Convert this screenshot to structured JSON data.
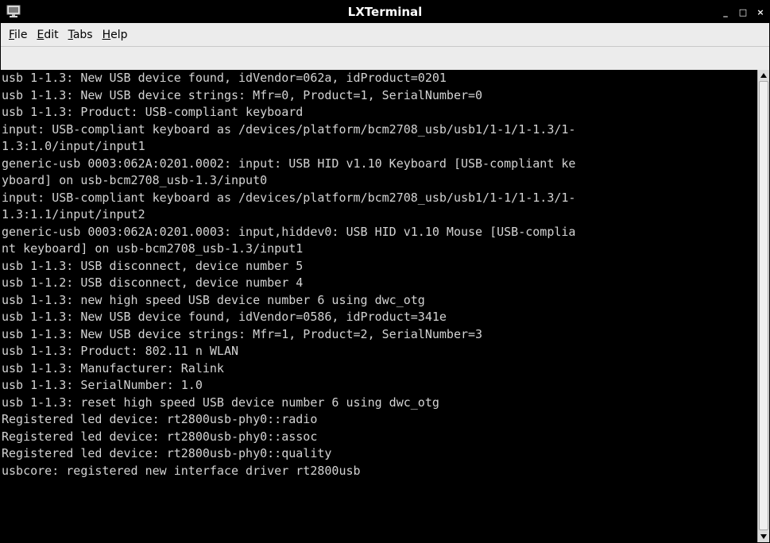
{
  "window": {
    "title": "LXTerminal",
    "controls": {
      "minimize": "_",
      "maximize": "□",
      "close": "×"
    }
  },
  "menu": {
    "items": [
      {
        "id": "file",
        "underline": "F",
        "rest": "ile"
      },
      {
        "id": "edit",
        "underline": "E",
        "rest": "dit"
      },
      {
        "id": "tabs",
        "underline": "T",
        "rest": "abs"
      },
      {
        "id": "help",
        "underline": "H",
        "rest": "elp"
      }
    ]
  },
  "terminal": {
    "lines": [
      "usb 1-1.3: New USB device found, idVendor=062a, idProduct=0201",
      "usb 1-1.3: New USB device strings: Mfr=0, Product=1, SerialNumber=0",
      "usb 1-1.3: Product: USB-compliant keyboard",
      "input: USB-compliant keyboard as /devices/platform/bcm2708_usb/usb1/1-1/1-1.3/1-",
      "1.3:1.0/input/input1",
      "generic-usb 0003:062A:0201.0002: input: USB HID v1.10 Keyboard [USB-compliant ke",
      "yboard] on usb-bcm2708_usb-1.3/input0",
      "input: USB-compliant keyboard as /devices/platform/bcm2708_usb/usb1/1-1/1-1.3/1-",
      "1.3:1.1/input/input2",
      "generic-usb 0003:062A:0201.0003: input,hiddev0: USB HID v1.10 Mouse [USB-complia",
      "nt keyboard] on usb-bcm2708_usb-1.3/input1",
      "usb 1-1.3: USB disconnect, device number 5",
      "usb 1-1.2: USB disconnect, device number 4",
      "usb 1-1.3: new high speed USB device number 6 using dwc_otg",
      "usb 1-1.3: New USB device found, idVendor=0586, idProduct=341e",
      "usb 1-1.3: New USB device strings: Mfr=1, Product=2, SerialNumber=3",
      "usb 1-1.3: Product: 802.11 n WLAN",
      "usb 1-1.3: Manufacturer: Ralink",
      "usb 1-1.3: SerialNumber: 1.0",
      "usb 1-1.3: reset high speed USB device number 6 using dwc_otg",
      "Registered led device: rt2800usb-phy0::radio",
      "Registered led device: rt2800usb-phy0::assoc",
      "Registered led device: rt2800usb-phy0::quality",
      "usbcore: registered new interface driver rt2800usb"
    ]
  },
  "icons": {
    "app": "terminal-app-icon",
    "scroll_up": "arrow-up-icon",
    "scroll_down": "arrow-down-icon"
  },
  "colors": {
    "terminal_bg": "#000000",
    "terminal_fg": "#d3d3d3",
    "titlebar_bg": "#000000",
    "menubar_bg": "#ececec"
  }
}
